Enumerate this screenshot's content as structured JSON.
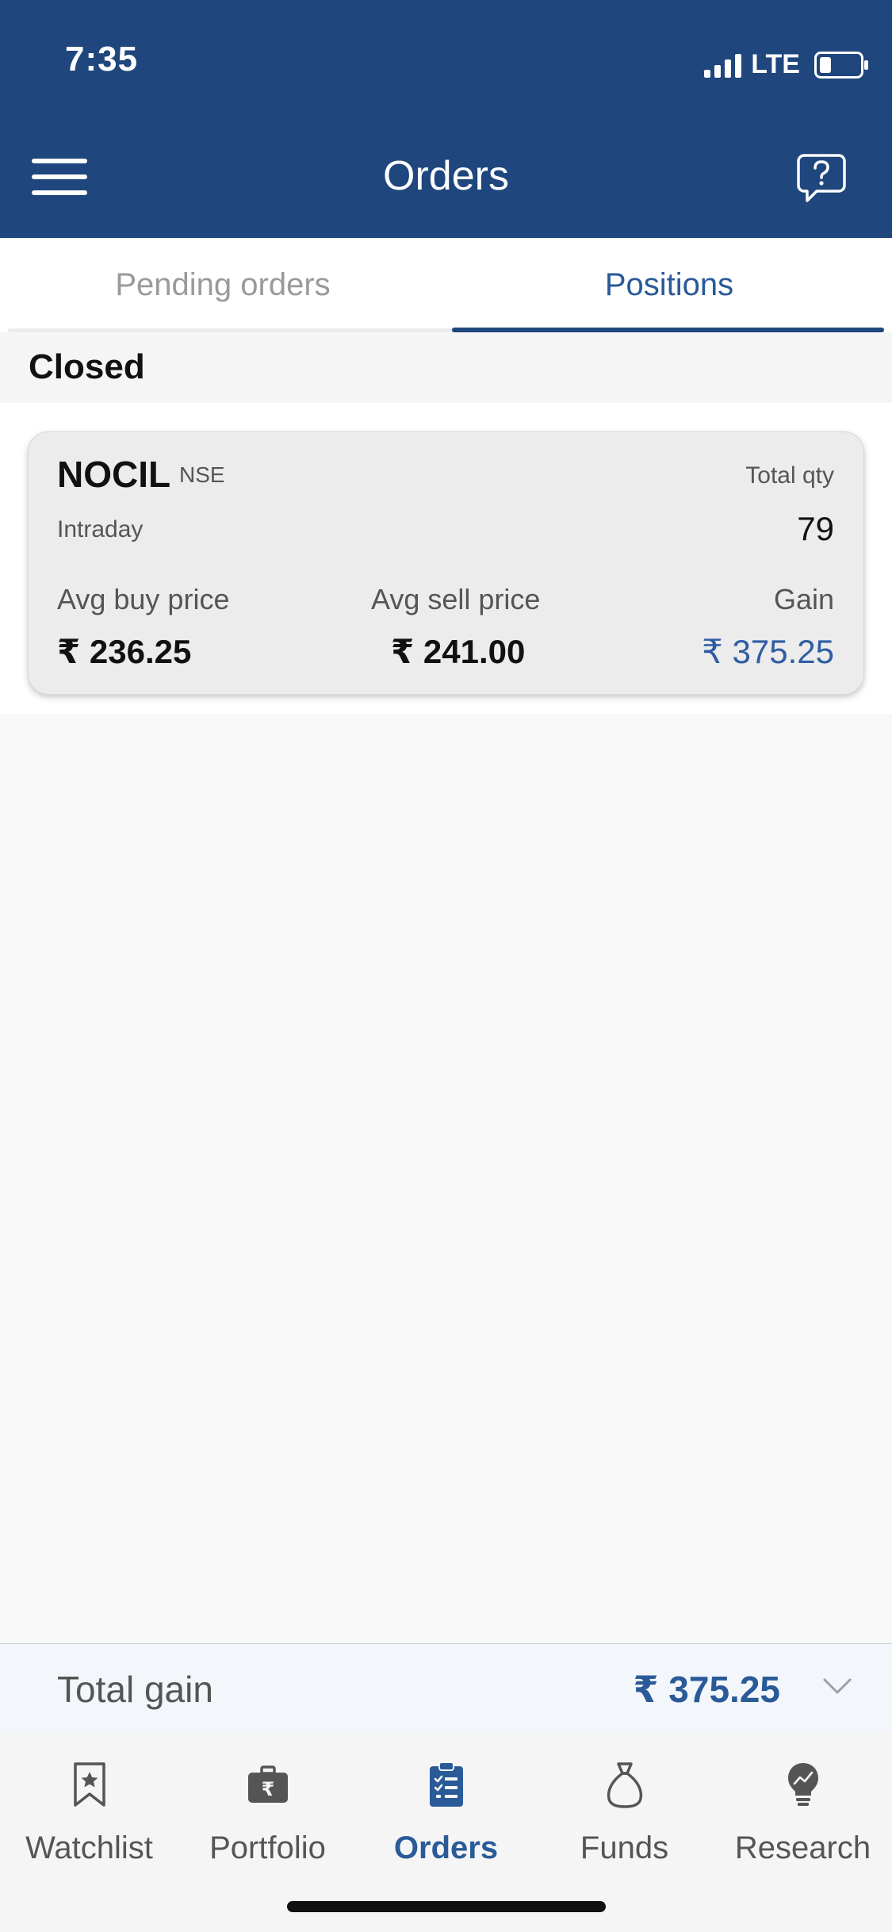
{
  "status_bar": {
    "time": "7:35",
    "network": "LTE",
    "battery_percent": 25
  },
  "header": {
    "title": "Orders",
    "menu_icon": "hamburger-menu-icon",
    "help_icon": "help-chat-icon"
  },
  "tabs": [
    {
      "label": "Pending orders",
      "active": false
    },
    {
      "label": "Positions",
      "active": true
    }
  ],
  "section": {
    "title": "Closed"
  },
  "position": {
    "symbol": "NOCIL",
    "exchange": "NSE",
    "product": "Intraday",
    "total_qty_label": "Total qty",
    "total_qty": "79",
    "avg_buy_label": "Avg buy price",
    "avg_buy": "₹ 236.25",
    "avg_sell_label": "Avg sell price",
    "avg_sell": "₹ 241.00",
    "gain_label": "Gain",
    "gain": "₹ 375.25"
  },
  "total": {
    "label": "Total gain",
    "value": "₹ 375.25"
  },
  "bottom_nav": [
    {
      "label": "Watchlist",
      "icon": "bookmark-star-icon",
      "active": false
    },
    {
      "label": "Portfolio",
      "icon": "briefcase-rupee-icon",
      "active": false
    },
    {
      "label": "Orders",
      "icon": "clipboard-list-icon",
      "active": true
    },
    {
      "label": "Funds",
      "icon": "money-bag-icon",
      "active": false
    },
    {
      "label": "Research",
      "icon": "lightbulb-chart-icon",
      "active": false
    }
  ],
  "colors": {
    "header_bg": "#1f467d",
    "accent": "#2a5a98",
    "gain": "#2f5da3"
  }
}
